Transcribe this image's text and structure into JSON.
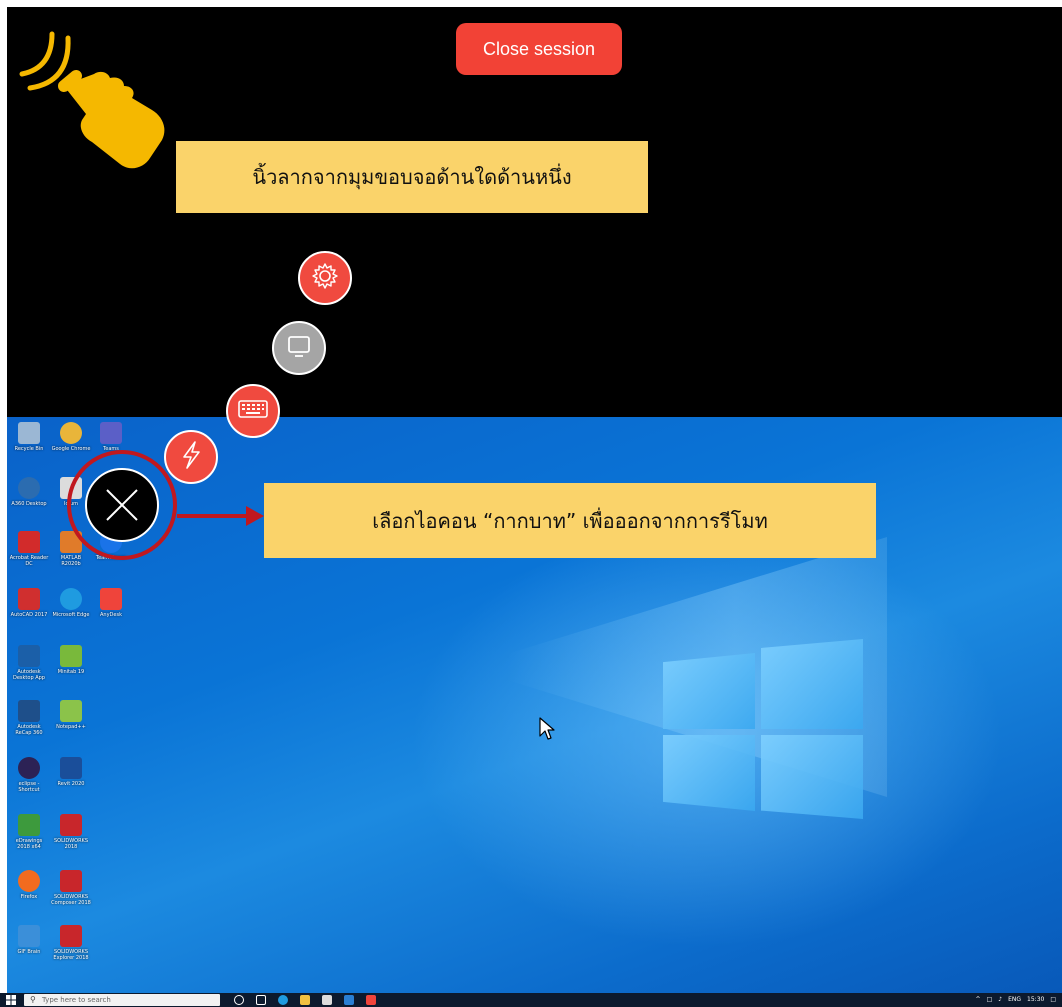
{
  "session": {
    "close_label": "Close session"
  },
  "hints": {
    "swipe": "นิ้วลากจากมุมขอบจอด้านใดด้านหนึ่ง",
    "exit": "เลือกไอคอน “กากบาท” เพื่อออกจากการรีโมท"
  },
  "floating_menu": {
    "items": [
      {
        "icon": "settings-gear-icon",
        "color": "#f04a3f"
      },
      {
        "icon": "monitor-icon",
        "color": "#a5a5a5"
      },
      {
        "icon": "keyboard-icon",
        "color": "#f04a3f"
      },
      {
        "icon": "lightning-icon",
        "color": "#f04a3f"
      },
      {
        "icon": "close-x-icon",
        "color": "#000000"
      }
    ]
  },
  "desktop": {
    "icons": [
      {
        "label": "Recycle Bin",
        "color": "#9bb7d4"
      },
      {
        "label": "Google Chrome",
        "color": "#e9b53a"
      },
      {
        "label": "Teams",
        "color": "#5b5fc7"
      },
      {
        "label": "A360 Desktop",
        "color": "#2b6cb0"
      },
      {
        "label": "Iolum",
        "color": "#dcdcdc"
      },
      {
        "label": "Acrobat Reader DC",
        "color": "#d22b2b"
      },
      {
        "label": "MATLAB R2020b",
        "color": "#e07b2a"
      },
      {
        "label": "TeamViewer",
        "color": "#1a73e8"
      },
      {
        "label": "AutoCAD 2017",
        "color": "#d02f2f"
      },
      {
        "label": "Microsoft Edge",
        "color": "#1f9be0"
      },
      {
        "label": "AnyDesk",
        "color": "#ef443b"
      },
      {
        "label": "Autodesk Desktop App",
        "color": "#1b5fa8"
      },
      {
        "label": "Minitab 19",
        "color": "#79b93b"
      },
      {
        "label": "Autodesk ReCap 360",
        "color": "#1e4f8a"
      },
      {
        "label": "Notepad++",
        "color": "#8bc34a"
      },
      {
        "label": "eclipse - Shortcut",
        "color": "#2c2255"
      },
      {
        "label": "Revit 2020",
        "color": "#1a4e9a"
      },
      {
        "label": "eDrawings 2018 x64",
        "color": "#3d9a3d"
      },
      {
        "label": "SOLIDWORKS 2018",
        "color": "#c8262b"
      },
      {
        "label": "Firefox",
        "color": "#f26b1f"
      },
      {
        "label": "SOLIDWORKS Composer 2018",
        "color": "#c8262b"
      },
      {
        "label": "GIF Brain",
        "color": "#3b8fd9"
      },
      {
        "label": "SOLIDWORKS Explorer 2018",
        "color": "#c8262b"
      }
    ]
  },
  "taskbar": {
    "search_placeholder": "Type here to search",
    "language": "ENG",
    "time": "15:30"
  }
}
